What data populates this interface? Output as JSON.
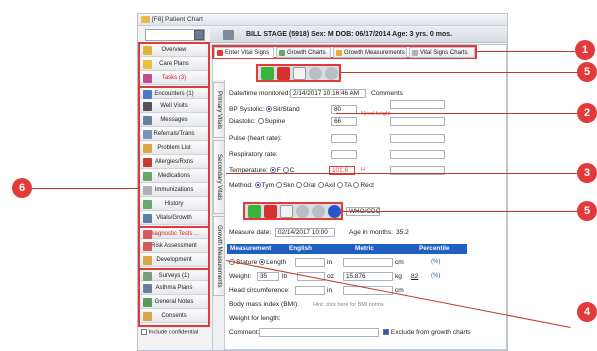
{
  "window": {
    "title": "[F8] Patient Chart"
  },
  "patient": {
    "header": "BILL STAGE (5918)  Sex: M  DOB: 06/17/2014  Age: 3 yrs. 0 mos."
  },
  "sidebar": {
    "items": [
      {
        "label": "Overview",
        "color": "#e2b13a"
      },
      {
        "label": "Care Plans",
        "color": "#e8c23c"
      },
      {
        "label": "Tasks (3)",
        "color": "#c24d8c"
      },
      {
        "label": "Encounters (1)",
        "color": "#4a7bc8"
      },
      {
        "label": "Well Visits",
        "color": "#555555"
      },
      {
        "label": "Messages",
        "color": "#6a7fa0"
      },
      {
        "label": "Referrals/Trans",
        "color": "#7c93b8"
      },
      {
        "label": "Problem List",
        "color": "#d9a44a"
      },
      {
        "label": "Allergies/Rxns",
        "color": "#c73b2f"
      },
      {
        "label": "Medications",
        "color": "#6aa66a"
      },
      {
        "label": "Immunizations",
        "color": "#b0b0b0"
      },
      {
        "label": "History",
        "color": "#6aa66a"
      },
      {
        "label": "Vitals/Growth",
        "color": "#5a7fa8"
      },
      {
        "label": "Diagnostic Tests ...",
        "color": "#d65a5a"
      },
      {
        "label": "Risk Assessment",
        "color": "#d65a5a"
      },
      {
        "label": "Development",
        "color": "#d9a44a"
      },
      {
        "label": "Surveys (1)",
        "color": "#7aa07a"
      },
      {
        "label": "Asthma Plans",
        "color": "#6a7fa0"
      },
      {
        "label": "General Notes",
        "color": "#5a9a5a"
      },
      {
        "label": "Consents",
        "color": "#d9a44a"
      }
    ],
    "include_confidential": "Include confidential"
  },
  "tabs": [
    {
      "label": "Enter Vital Signs",
      "color": "#e23a3a"
    },
    {
      "label": "Growth Charts",
      "color": "#6aa66a"
    },
    {
      "label": "Growth Measurements",
      "color": "#e2b13a"
    },
    {
      "label": "Vital Signs Charts",
      "color": "#b0b0b0"
    }
  ],
  "side_tabs": [
    "Primary Vitals",
    "Secondary Vitals",
    "Growth Measurements"
  ],
  "vitals": {
    "date_label": "Date/time monitored:",
    "date_value": "2/14/2017 10:16:46 AM",
    "comments_label": "Comments",
    "bp_systolic": "BP Systolic:",
    "sit_stand": "Sit/Stand",
    "systolic_value": "80",
    "diastolic": "Diastolic:",
    "supine": "Supine",
    "diastolic_value": "66",
    "note_red": "Need height",
    "pulse": "Pulse (heart rate):",
    "resp": "Respiratory rate:",
    "temp": "Temperature:",
    "temp_f": "F",
    "temp_c": "C",
    "temp_value": "101.6",
    "temp_flag": "H",
    "method": "Method:",
    "methods": [
      "Tym",
      "Skn",
      "Oral",
      "Axil",
      "TA",
      "Rect"
    ]
  },
  "growth": {
    "standard": "WHO/CDC",
    "measure_date_label": "Measure date:",
    "measure_date": "02/14/2017 10:00",
    "age_label": "Age in months:",
    "age_value": "35.2",
    "headers": [
      "Measurement",
      "English",
      "Metric",
      "Percentile"
    ],
    "stature": "Stature",
    "length": "Length",
    "in": "in",
    "cm": "cm",
    "weight": "Weight:",
    "weight_lb": "35",
    "lb": "lb",
    "oz": "oz",
    "weight_kg": "15.876",
    "kg": "kg",
    "percentile": "82",
    "head": "Head circumference:",
    "bmi": "Body mass index (BMI):",
    "bmi_hint": "Hint: click here for BMI norms",
    "wfl": "Weight for length:",
    "comment": "Comment:",
    "exclude": "Exclude from growth charts",
    "chart_icon": "(%)"
  },
  "callouts": [
    "1",
    "2",
    "3",
    "4",
    "5",
    "5",
    "6"
  ]
}
